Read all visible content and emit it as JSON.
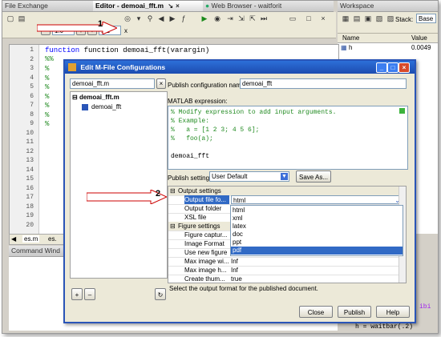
{
  "panels": {
    "file_exchange": "File Exchange",
    "editor_title": "Editor - demoai_fft.m",
    "browser_title": "Web Browser - waitforit",
    "workspace_title": "Workspace",
    "command_window": "Command Wind"
  },
  "toolbar": {
    "zoom_minus": "-",
    "zoom_value": "1.0",
    "zoom_plus": "+",
    "divide": "÷",
    "step_value": "1.1",
    "x_label": "x",
    "stack_label": "Stack:",
    "stack_value": "Base"
  },
  "workspace": {
    "col_name": "Name",
    "col_value": "Value",
    "rows": [
      {
        "name": "h",
        "value": "0.0049"
      }
    ]
  },
  "editor": {
    "line_numbers": [
      "1",
      "2",
      "3",
      "4",
      "5",
      "6",
      "7",
      "8",
      "9",
      "10",
      "11",
      "12",
      "13",
      "14",
      "15",
      "16",
      "17",
      "18",
      "19",
      "20"
    ],
    "line1": "function demoai_fft(varargin)",
    "line2": "%%",
    "comment_marker": "%",
    "bottom_code": "h = waitbar(.2)",
    "right_fragment": "ibi"
  },
  "tabs_bottom": [
    "es.m",
    "es."
  ],
  "dialog": {
    "title": "Edit M-File Configurations",
    "search_value": "demoai_fft.m",
    "tree_root": "demoai_fft.m",
    "tree_child": "demoai_fft",
    "config_name_label": "Publish configuration name:",
    "config_name_value": "demoai_fft",
    "matlab_expr_label": "MATLAB expression:",
    "expr_lines": [
      "% Modify expression to add input arguments.",
      "% Example:",
      "%   a = [1 2 3; 4 5 6];",
      "%   foo(a);",
      "",
      "demoai_fft"
    ],
    "publish_settings_label": "Publish settings:",
    "publish_settings_value": "User Default",
    "save_as_label": "Save As...",
    "output_settings_header": "Output settings",
    "output_rows": [
      {
        "name": "Output file fo...",
        "value": "html"
      },
      {
        "name": "Output folder",
        "value": ""
      },
      {
        "name": "XSL file",
        "value": ""
      }
    ],
    "format_options": [
      "html",
      "xml",
      "latex",
      "doc",
      "ppt",
      "pdf"
    ],
    "selected_format": "pdf",
    "figure_settings_header": "Figure settings",
    "figure_rows": [
      {
        "name": "Figure captur...",
        "value": ""
      },
      {
        "name": "Image Format",
        "value": ""
      },
      {
        "name": "Use new figure",
        "value": "true"
      },
      {
        "name": "Max image wi...",
        "value": "Inf"
      },
      {
        "name": "Max image h...",
        "value": "Inf"
      },
      {
        "name": "Create thum...",
        "value": "true"
      }
    ],
    "hint": "Select the output format for the published document.",
    "add_btn": "+",
    "remove_btn": "–",
    "close_btn": "Close",
    "publish_btn": "Publish",
    "help_btn": "Help"
  },
  "callouts": {
    "first": "1",
    "second": "2"
  },
  "colors": {
    "callout_red": "#cc0000",
    "selected_blue": "#316ac5",
    "comment_green": "#228b22",
    "title_blue": "#1c4cb0"
  }
}
